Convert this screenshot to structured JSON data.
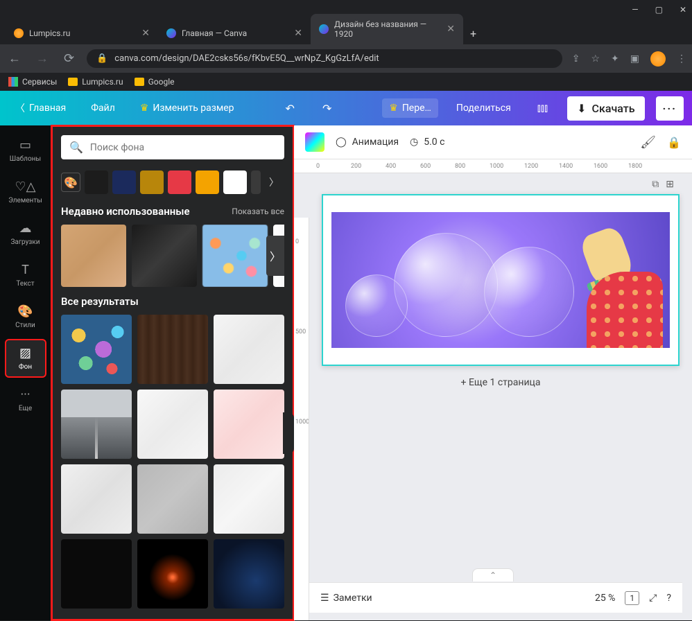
{
  "browser": {
    "tabs": [
      {
        "title": "Lumpics.ru"
      },
      {
        "title": "Главная — Canva"
      },
      {
        "title": "Дизайн без названия — 1920"
      }
    ],
    "url": "canva.com/design/DAE2csks56s/fKbvE5Q__wrNpZ_KgGzLfA/edit",
    "bookmarks": {
      "services": "Сервисы",
      "lumpics": "Lumpics.ru",
      "google": "Google"
    }
  },
  "toolbar": {
    "home": "Главная",
    "file": "Файл",
    "resize": "Изменить размер",
    "translate": "Пере…",
    "share": "Поделиться",
    "download": "Скачать"
  },
  "sidebar": {
    "templates": "Шаблоны",
    "elements": "Элементы",
    "uploads": "Загрузки",
    "text": "Текст",
    "styles": "Стили",
    "background": "Фон",
    "more": "Еще"
  },
  "panel": {
    "search_placeholder": "Поиск фона",
    "colors": [
      "#1c1c1c",
      "#1b2a5c",
      "#b8860b",
      "#e63946",
      "#f4a300",
      "#ffffff",
      "#3a3a3a"
    ],
    "recent_title": "Недавно использованные",
    "show_all": "Показать все",
    "all_results": "Все результаты"
  },
  "canvas": {
    "animation": "Анимация",
    "duration": "5.0 с",
    "add_page": "+ Еще 1 страница",
    "ruler_h": [
      "0",
      "200",
      "400",
      "600",
      "800",
      "1000",
      "1200",
      "1400",
      "1600",
      "1800"
    ],
    "ruler_v": [
      "0",
      "500",
      "1000"
    ]
  },
  "bottombar": {
    "notes": "Заметки",
    "zoom": "25 %",
    "page": "1"
  }
}
